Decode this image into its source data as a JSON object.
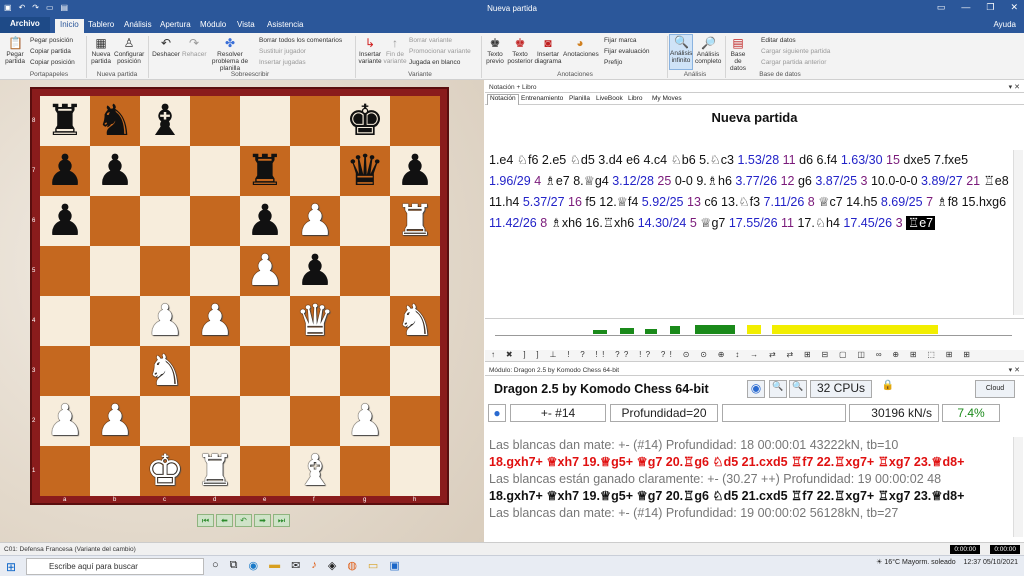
{
  "window": {
    "title": "Nueva partida",
    "help": "Ayuda"
  },
  "menu": {
    "archivo": "Archivo",
    "tabs": [
      "Inicio",
      "Tablero",
      "Análisis",
      "Apertura",
      "Módulo",
      "Vista",
      "Asistencia"
    ]
  },
  "ribbon": {
    "clipboard": {
      "paste_game": "Pegar partida",
      "paste_position": "Pegar posición",
      "copy_game": "Copiar partida",
      "copy_position": "Copiar posición",
      "group": "Portapapeles"
    },
    "new_game": {
      "new": "Nueva partida",
      "setup": "Configurar posición",
      "group": "Nueva partida"
    },
    "edit": {
      "undo": "Deshacer",
      "redo": "Rehacer",
      "solve": "Resolver problema de planilla",
      "delete_comments": "Borrar todos los comentarios",
      "replace_player": "Sustituir jugador",
      "insert_players": "Insertar jugadas",
      "group": "Sobreescribir"
    },
    "variant": {
      "insert": "Insertar variante",
      "end": "Fin de variante",
      "delete": "Borrar variante",
      "promote": "Promocionar variante",
      "blank": "Jugada en blanco",
      "group": "Variante"
    },
    "annotations": {
      "pre_text": "Texto previo",
      "post_text": "Texto posterior",
      "diagram": "Insertar diagrama",
      "annotations": "Anotaciones",
      "mark": "Fijar marca",
      "eval": "Fijar evaluación",
      "prefix": "Prefijo",
      "group": "Anotaciones"
    },
    "analysis": {
      "infinite": "Análisis infinito",
      "complete": "Análisis completo",
      "group": "Análisis"
    },
    "database": {
      "db": "Base de datos",
      "edit": "Editar datos",
      "next": "Cargar siguiente partida",
      "prev": "Cargar partida anterior",
      "group": "Base de datos"
    }
  },
  "board": {
    "ranks": [
      "8",
      "7",
      "6",
      "5",
      "4",
      "3",
      "2",
      "1"
    ],
    "files": [
      "a",
      "b",
      "c",
      "d",
      "e",
      "f",
      "g",
      "h"
    ],
    "pieces": [
      [
        "♜",
        "♞",
        "♝",
        "",
        "",
        "",
        "♚",
        ""
      ],
      [
        "♟",
        "♟",
        "",
        "",
        "♜",
        "",
        "♛",
        "♟"
      ],
      [
        "♟",
        "",
        "",
        "",
        "♟",
        "♙",
        "",
        "♖"
      ],
      [
        "",
        "",
        "",
        "",
        "♙",
        "♟",
        "",
        ""
      ],
      [
        "",
        "",
        "♙",
        "♙",
        "",
        "♕",
        "",
        "♘"
      ],
      [
        "",
        "",
        "♘",
        "",
        "",
        "",
        "",
        ""
      ],
      [
        "♙",
        "♙",
        "",
        "",
        "",
        "",
        "♙",
        ""
      ],
      [
        "",
        "",
        "♔",
        "♖",
        "",
        "♗",
        "",
        ""
      ]
    ],
    "nav": [
      "⏮",
      "⬅",
      "↶",
      "➡",
      "⏭"
    ]
  },
  "notation_panel": {
    "header": "Notación + Libro",
    "tabs": [
      "Notación",
      "Entrenamiento",
      "Planilla",
      "LiveBook",
      "Libro",
      "My Moves"
    ],
    "game_title": "Nueva partida",
    "moves": [
      {
        "t": "1.e4 ♘f6 2.e5 ♘d5 3.d4 e6 4.c4 ♘b6 5.♘c3 "
      },
      {
        "t": "1.53/28",
        "c": "ev"
      },
      {
        "t": " 11",
        "c": "dp"
      },
      {
        "t": " d6 6.f4 "
      },
      {
        "t": "1.63/30",
        "c": "ev"
      },
      {
        "t": " 15",
        "c": "dp"
      },
      {
        "t": " dxe5 7.fxe5 "
      },
      {
        "t": "1.96/29",
        "c": "ev"
      },
      {
        "t": " 4",
        "c": "dp"
      },
      {
        "t": " ♗e7 8.♕g4 "
      },
      {
        "t": "3.12/28",
        "c": "ev"
      },
      {
        "t": " 25",
        "c": "dp"
      },
      {
        "t": " 0-0 9.♗h6 "
      },
      {
        "t": "3.77/26",
        "c": "ev"
      },
      {
        "t": " 12",
        "c": "dp"
      },
      {
        "t": " g6 "
      },
      {
        "t": "3.87/25",
        "c": "ev"
      },
      {
        "t": " 3",
        "c": "dp"
      },
      {
        "t": " 10.0-0-0 "
      },
      {
        "t": "3.89/27",
        "c": "ev"
      },
      {
        "t": " 21",
        "c": "dp"
      },
      {
        "t": " ♖e8 11.h4 "
      },
      {
        "t": "5.37/27",
        "c": "ev"
      },
      {
        "t": " 16",
        "c": "dp"
      },
      {
        "t": " f5 12.♕f4 "
      },
      {
        "t": "5.92/25",
        "c": "ev"
      },
      {
        "t": " 13",
        "c": "dp"
      },
      {
        "t": " c6 13.♘f3 "
      },
      {
        "t": "7.11/26",
        "c": "ev"
      },
      {
        "t": " 8",
        "c": "dp"
      },
      {
        "t": " ♕c7 14.h5 "
      },
      {
        "t": "8.69/25",
        "c": "ev"
      },
      {
        "t": " 7",
        "c": "dp"
      },
      {
        "t": " ♗f8 15.hxg6 "
      },
      {
        "t": "11.42/26",
        "c": "ev"
      },
      {
        "t": " 8",
        "c": "dp"
      },
      {
        "t": " ♗xh6 16.♖xh6 "
      },
      {
        "t": "14.30/24",
        "c": "ev"
      },
      {
        "t": " 5",
        "c": "dp"
      },
      {
        "t": " ♕g7 "
      },
      {
        "t": "17.55/26",
        "c": "ev"
      },
      {
        "t": " 11",
        "c": "dp"
      },
      {
        "t": " 17.♘h4 "
      },
      {
        "t": "17.45/26",
        "c": "ev"
      },
      {
        "t": " 3",
        "c": "dp"
      },
      {
        "t": " "
      },
      {
        "t": "♖e7",
        "c": "cur"
      }
    ],
    "symbols": "↑ ✖ ] ] ⊥ ! ? !! ?? !? ?! ⊙ ⊙ ⊕ ↕ → ⇄ ⇄ ⊞ ⊟ ▢ ◫ ∞ ⊕ ⊞ ⬚ ⊞ ⊞"
  },
  "engine_panel": {
    "header": "Módulo: Dragon 2.5 by Komodo Chess 64-bit",
    "name": "Dragon 2.5 by Komodo Chess 64-bit",
    "cpus": "32 CPUs",
    "cloud": "Cloud",
    "eval": "+- #14",
    "depth": "Profundidad=20",
    "speed": "30196 kN/s",
    "percent": "7.4%",
    "lines": [
      {
        "t": "Las blancas dan mate: +- (#14)  Profundidad: 18   00:00:01  43222kN, tb=10",
        "c": "g"
      },
      {
        "t": "18.gxh7+ ♕xh7 19.♕g5+ ♕g7 20.♖g6 ♘d5 21.cxd5 ♖f7 22.♖xg7+ ♖xg7 23.♕d8+",
        "c": "r"
      },
      {
        "t": "Las blancas están ganado claramente: +- (30.27 ++)  Profundidad: 19   00:00:02  48",
        "c": "g"
      },
      {
        "t": "18.gxh7+ ♕xh7 19.♕g5+ ♕g7 20.♖g6 ♘d5 21.cxd5 ♖f7 22.♖xg7+ ♖xg7 23.♕d8+",
        "c": "k"
      },
      {
        "t": "Las blancas dan mate: +- (#14)  Profundidad: 19   00:00:02  56128kN, tb=27",
        "c": "g"
      }
    ]
  },
  "status": {
    "message": "C01: Defensa Francesa (Variante del cambio)",
    "clock1": "0:00:00",
    "clock2": "0:00:00"
  },
  "taskbar": {
    "search": "Escribe aquí para buscar",
    "weather": "16°C  Mayorm. soleado",
    "time": "12:37",
    "date": "05/10/2021"
  }
}
